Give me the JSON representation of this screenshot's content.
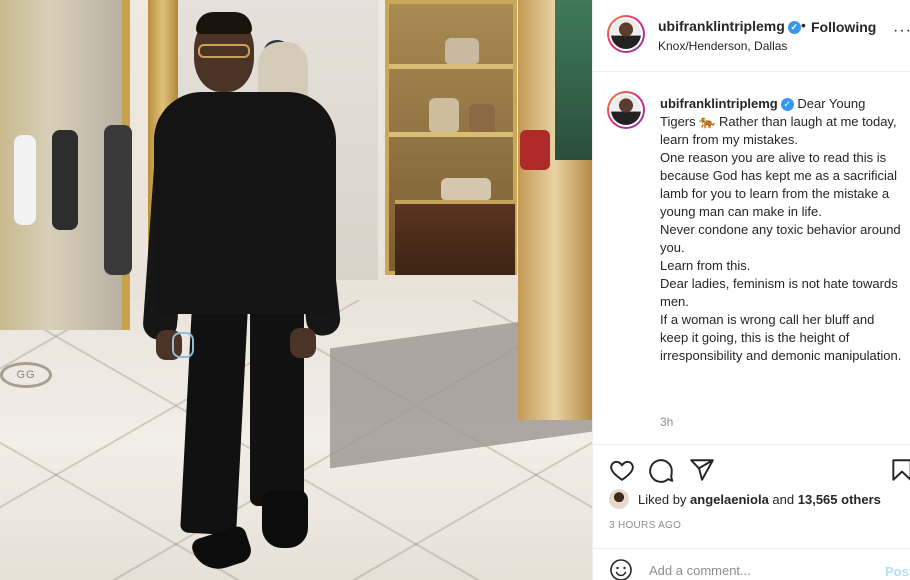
{
  "post": {
    "username": "ubifranklintriplemg",
    "verified_icon": "verified-badge-icon",
    "separator": "•",
    "follow_status": "Following",
    "location": "Knox/Henderson, Dallas",
    "more_icon": "more-options-icon"
  },
  "caption": {
    "username": "ubifranklintriplemg",
    "lines": [
      "Dear Young Tigers 🐅 Rather than laugh at me today, learn from my mistakes.",
      "One reason you are alive to read this is because God has kept me as a sacrificial lamb for you to learn from the mistake a young man can make in life.",
      "Never condone any toxic behavior around you.",
      "Learn from this.",
      "Dear ladies, feminism is not hate towards men.",
      "If a woman is wrong call her bluff and keep it going, this is the height of irresponsibility and demonic manipulation."
    ],
    "relative_time": "3h"
  },
  "actions": {
    "icons": [
      "heart-icon",
      "comment-icon",
      "share-icon",
      "bookmark-icon"
    ]
  },
  "likes": {
    "prefix": "Liked by",
    "user": "angelaeniola",
    "conjunction": "and",
    "others": "13,565 others"
  },
  "timestamp": "3 HOURS AGO",
  "comment_box": {
    "placeholder": "Add a comment...",
    "post_label": "Post"
  },
  "colors": {
    "link_blue_disabled": "#b2dffc",
    "verified_blue": "#3897f0",
    "text": "#262626",
    "muted": "#8e8e8e"
  }
}
